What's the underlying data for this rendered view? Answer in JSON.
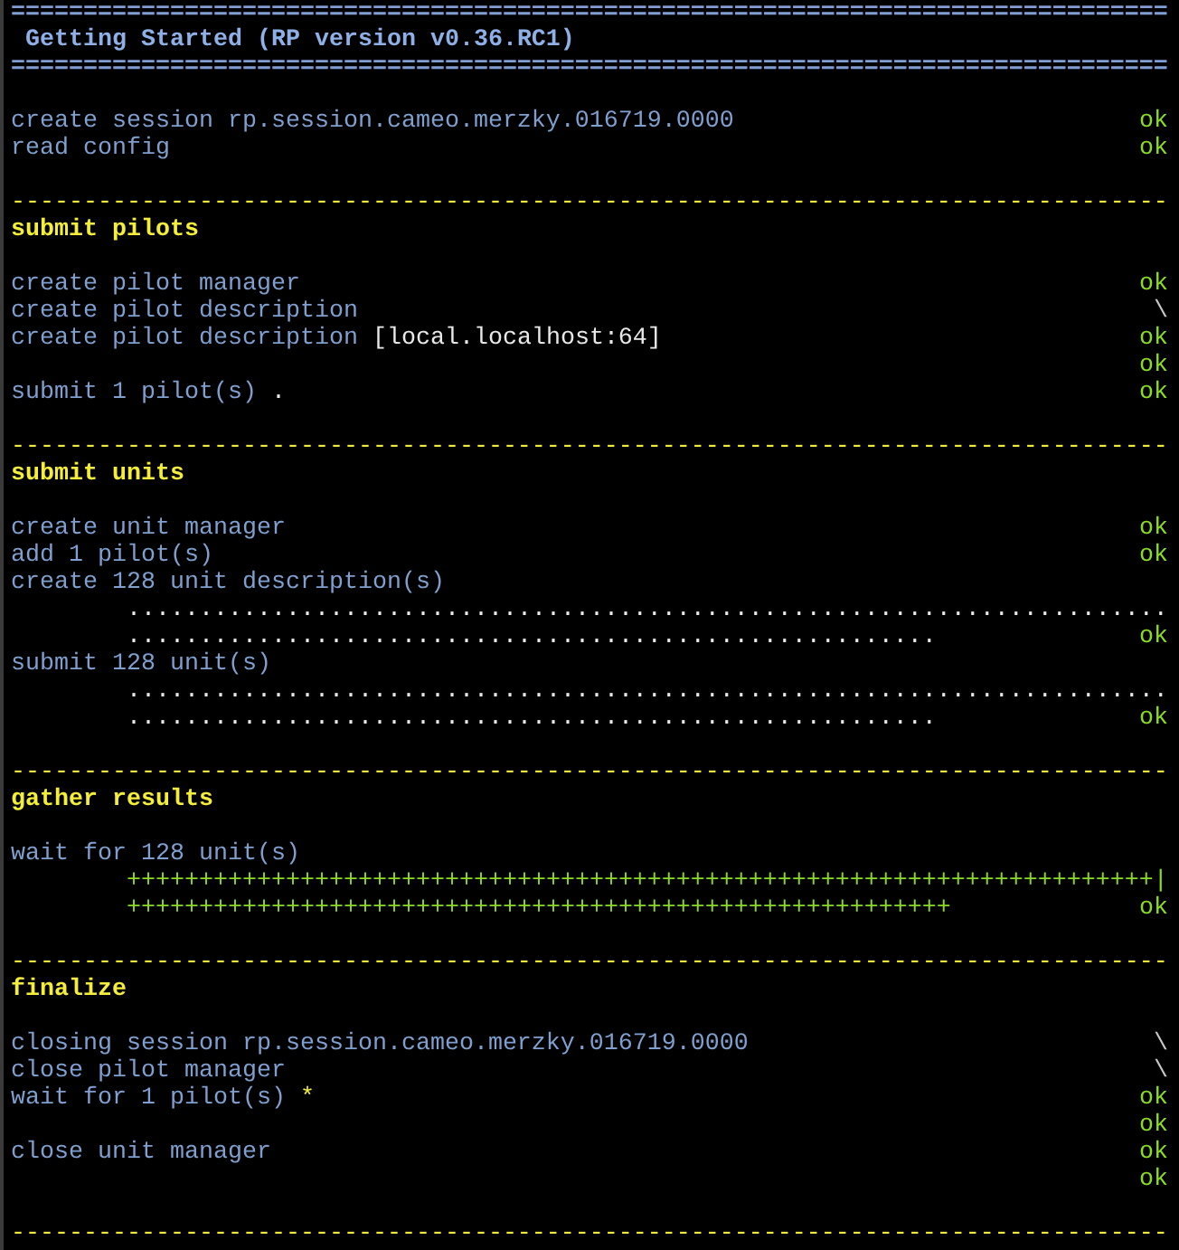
{
  "header": {
    "rule_top": "================================================================================",
    "title": "Getting Started (RP version v0.36.RC1)",
    "rule_bottom": "================================================================================"
  },
  "intro": [
    {
      "kind": "blank"
    },
    {
      "kind": "step",
      "text": "create session rp.session.cameo.merzky.016719.0000",
      "status": "ok",
      "done": true
    },
    {
      "kind": "step",
      "text": "read config",
      "status": "ok",
      "done": true
    },
    {
      "kind": "blank"
    }
  ],
  "sections": [
    {
      "rule": "--------------------------------------------------------------------------------",
      "title": "submit pilots",
      "lines": [
        {
          "kind": "blank"
        },
        {
          "kind": "step",
          "text": "create pilot manager",
          "status": "ok",
          "done": true
        },
        {
          "kind": "step",
          "text": "create pilot description",
          "status": "\\",
          "done": false
        },
        {
          "kind": "step",
          "text": "create pilot description",
          "detail": "[local.localhost:64]",
          "status": "ok",
          "done": true
        },
        {
          "kind": "step",
          "status": "ok",
          "done": true
        },
        {
          "kind": "step",
          "text": "submit 1 pilot(s)",
          "detail": ".",
          "status": "ok",
          "done": true
        },
        {
          "kind": "blank"
        }
      ]
    },
    {
      "rule": "--------------------------------------------------------------------------------",
      "title": "submit units",
      "lines": [
        {
          "kind": "blank"
        },
        {
          "kind": "step",
          "text": "create unit manager",
          "status": "ok",
          "done": true
        },
        {
          "kind": "step",
          "text": "add 1 pilot(s)",
          "status": "ok",
          "done": true
        },
        {
          "kind": "step",
          "text": "create 128 unit description(s)"
        },
        {
          "kind": "dots",
          "text": "........................................................................"
        },
        {
          "kind": "dots",
          "text": "........................................................",
          "status": "ok",
          "done": true
        },
        {
          "kind": "step",
          "text": "submit 128 unit(s)"
        },
        {
          "kind": "dots",
          "text": "........................................................................"
        },
        {
          "kind": "dots",
          "text": "........................................................",
          "status": "ok",
          "done": true
        },
        {
          "kind": "blank"
        }
      ]
    },
    {
      "rule": "--------------------------------------------------------------------------------",
      "title": "gather results",
      "lines": [
        {
          "kind": "blank"
        },
        {
          "kind": "step",
          "text": "wait for 128 unit(s)"
        },
        {
          "kind": "plus",
          "text": "+++++++++++++++++++++++++++++++++++++++++++++++++++++++++++++++++++++++|"
        },
        {
          "kind": "plus",
          "text": "+++++++++++++++++++++++++++++++++++++++++++++++++++++++++",
          "status": "ok",
          "done": true
        },
        {
          "kind": "blank"
        }
      ]
    },
    {
      "rule": "--------------------------------------------------------------------------------",
      "title": "finalize",
      "lines": [
        {
          "kind": "blank"
        },
        {
          "kind": "step",
          "text": "closing session rp.session.cameo.merzky.016719.0000",
          "status": "\\",
          "done": false
        },
        {
          "kind": "step",
          "text": "close pilot manager",
          "status": "\\",
          "done": false
        },
        {
          "kind": "step",
          "text": "wait for 1 pilot(s)",
          "marker": "*",
          "status": "ok",
          "done": true
        },
        {
          "kind": "step",
          "status": "ok",
          "done": true
        },
        {
          "kind": "step",
          "text": "close unit manager",
          "status": "ok",
          "done": true
        },
        {
          "kind": "step",
          "status": "ok",
          "done": true
        },
        {
          "kind": "blank"
        }
      ]
    }
  ],
  "closing_rule": "--------------------------------------------------------------------------------"
}
